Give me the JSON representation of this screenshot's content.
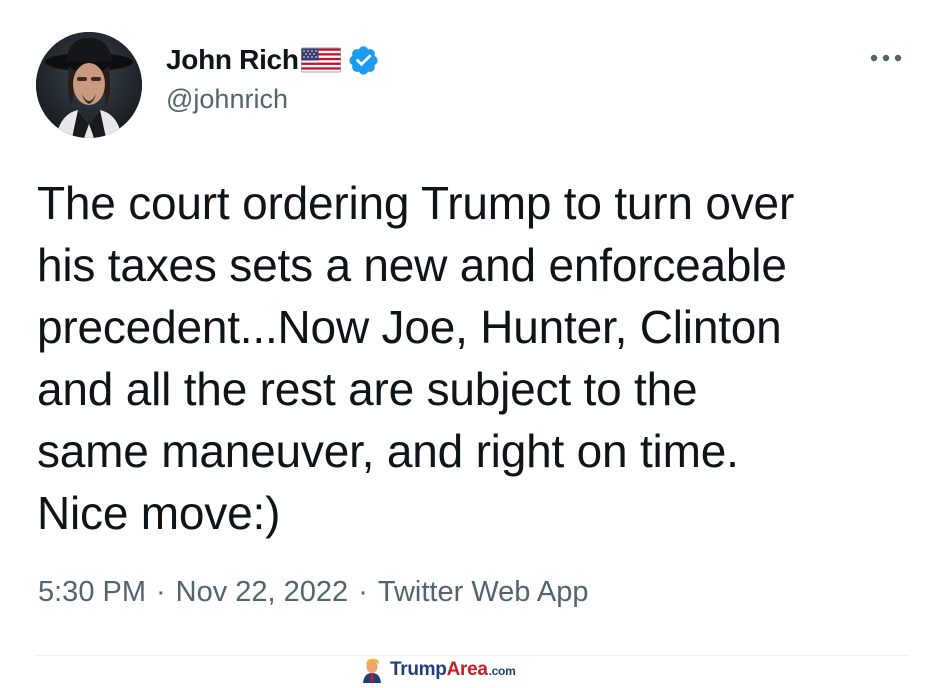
{
  "author": {
    "display_name": "John Rich",
    "handle": "@johnrich",
    "avatar_icon": "profile-photo-cowboy-hat",
    "flag_icon": "us-flag-emoji",
    "verified_icon": "verified-badge",
    "verified_color": "#1d9bf0"
  },
  "menu": {
    "more_icon": "more-horizontal-icon"
  },
  "tweet": {
    "text": "The court ordering Trump to turn over\nhis taxes sets a new and enforceable\nprecedent...Now Joe, Hunter, Clinton\nand all the rest are subject to the\nsame maneuver, and right on time.\nNice move:)",
    "time": "5:30 PM",
    "separator": "·",
    "date": "Nov 22, 2022",
    "source": "Twitter Web App"
  },
  "watermark": {
    "text_trump": "Trump",
    "text_area": "Area",
    "text_com": ".com",
    "icon": "trump-cartoon-icon",
    "colors": {
      "trump": "#1f3e7a",
      "area": "#c41e24"
    }
  },
  "colors": {
    "text_primary": "#0f1419",
    "text_secondary": "#536471",
    "divider": "#eff3f4"
  }
}
